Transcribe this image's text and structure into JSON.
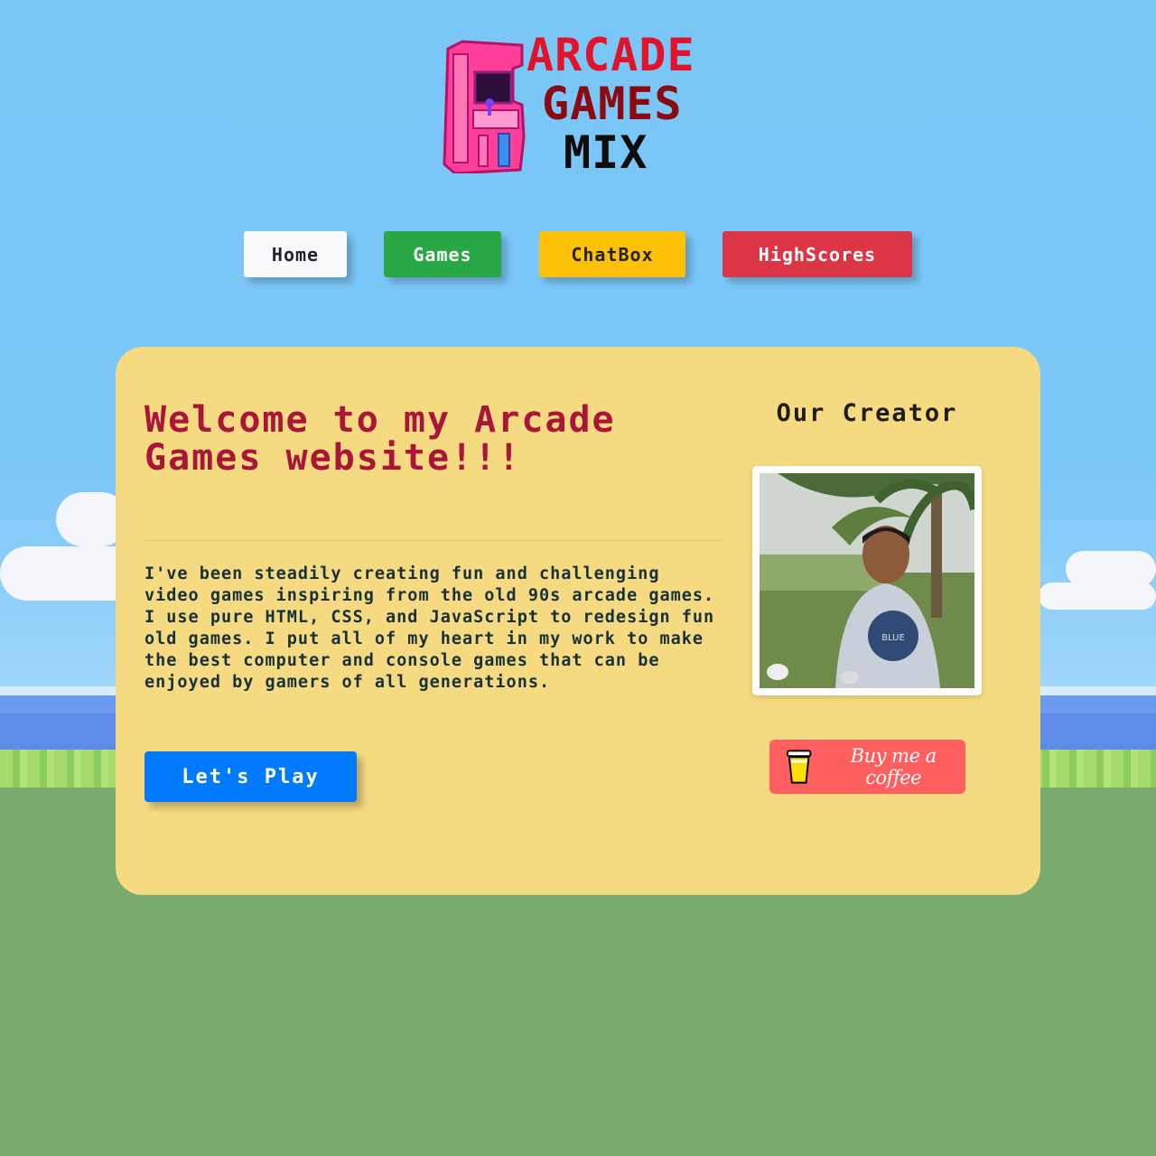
{
  "logo": {
    "line1": "ARCADE",
    "line2": "GAMES",
    "line3": "MIX",
    "cabinet_text": "ARCADE"
  },
  "nav": {
    "home": "Home",
    "games": "Games",
    "chatbox": "ChatBox",
    "highscores": "HighScores"
  },
  "main": {
    "title": "Welcome to my Arcade Games website!!!",
    "intro": "I've been steadily creating fun and challenging video games inspiring from the old 90s arcade games. I use pure HTML, CSS, and JavaScript to redesign fun old games. I put all of my heart in my work to make the best computer and console games that can be enjoyed by gamers of all generations.",
    "cta_label": "Let's Play"
  },
  "creator": {
    "heading": "Our Creator",
    "coffee_label": "Buy me a coffee"
  },
  "colors": {
    "sky": "#7ac6f7",
    "card": "#f6da82",
    "title": "#a9163a",
    "cta": "#007bff",
    "coffee": "#ff5f5f"
  },
  "icons": [
    "arcade-cabinet-icon",
    "coffee-cup-icon"
  ]
}
